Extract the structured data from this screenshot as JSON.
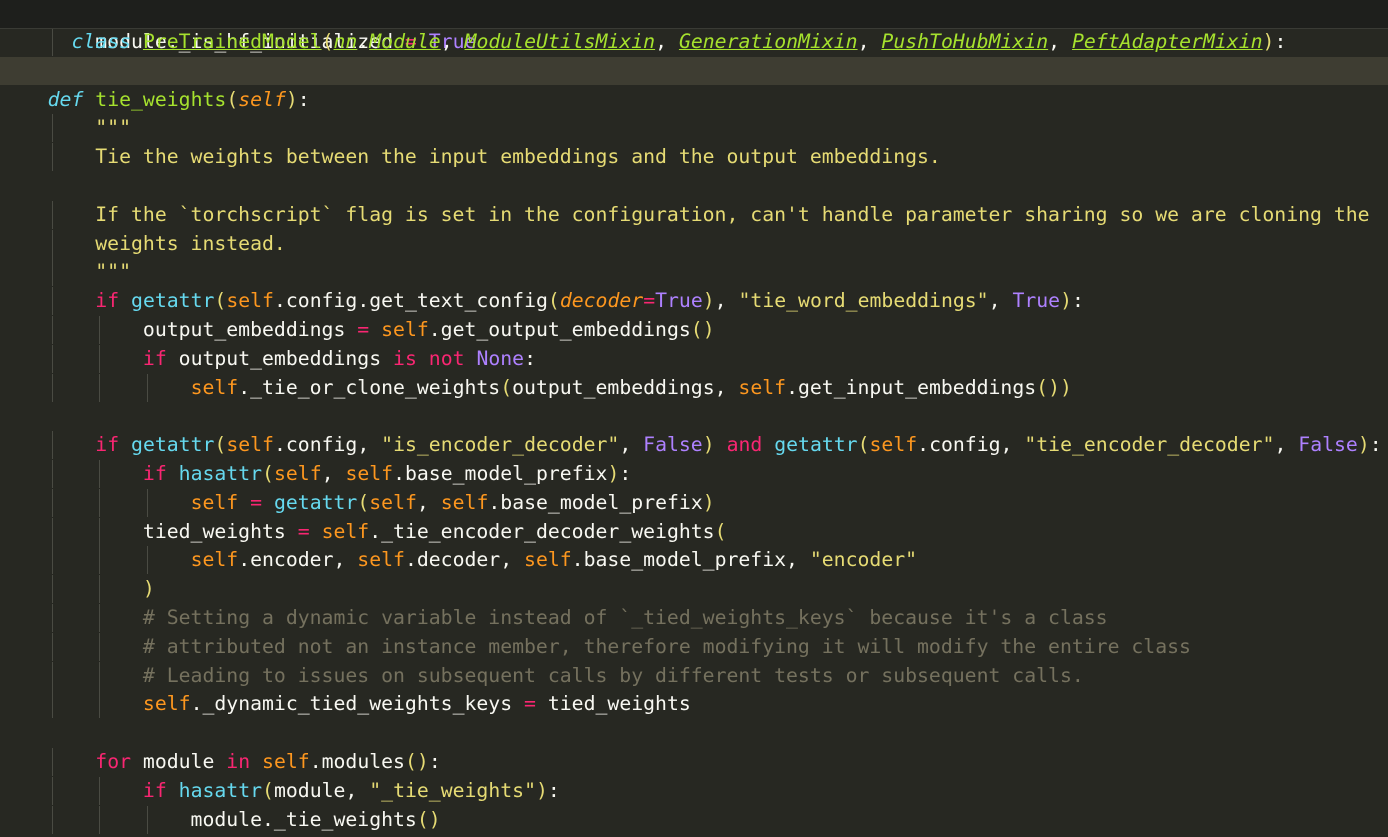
{
  "editor": {
    "sticky_header": "class PreTrainedModel(nn.Module, ModuleUtilsMixin, GenerationMixin, PushToHubMixin, PeftAdapterMixin):",
    "lines": [
      "        module._is_hf_initialized = True",
      "",
      "    def tie_weights(self):",
      "        \"\"\"",
      "        Tie the weights between the input embeddings and the output embeddings.",
      "",
      "        If the `torchscript` flag is set in the configuration, can't handle parameter sharing so we are cloning the",
      "        weights instead.",
      "        \"\"\"",
      "        if getattr(self.config.get_text_config(decoder=True), \"tie_word_embeddings\", True):",
      "            output_embeddings = self.get_output_embeddings()",
      "            if output_embeddings is not None:",
      "                self._tie_or_clone_weights(output_embeddings, self.get_input_embeddings())",
      "",
      "        if getattr(self.config, \"is_encoder_decoder\", False) and getattr(self.config, \"tie_encoder_decoder\", False):",
      "            if hasattr(self, self.base_model_prefix):",
      "                self = getattr(self, self.base_model_prefix)",
      "            tied_weights = self._tie_encoder_decoder_weights(",
      "                self.encoder, self.decoder, self.base_model_prefix, \"encoder\"",
      "            )",
      "            # Setting a dynamic variable instead of `_tied_weights_keys` because it's a class",
      "            # attributed not an instance member, therefore modifying it will modify the entire class",
      "            # Leading to issues on subsequent calls by different tests or subsequent calls.",
      "            self._dynamic_tied_weights_keys = tied_weights",
      "",
      "        for module in self.modules():",
      "            if hasattr(module, \"_tie_weights\"):",
      "                module._tie_weights()"
    ],
    "current_line": 1
  },
  "theme": {
    "background": "#272822",
    "sticky_background": "#1e1f1c",
    "current_line": "#3e3d32",
    "keyword": "#f92672",
    "string": "#e6db74",
    "function": "#a6e22e",
    "builtin": "#66d9ef",
    "self": "#fd971f",
    "constant": "#ae81ff",
    "comment": "#75715e",
    "text": "#f8f8f2"
  }
}
